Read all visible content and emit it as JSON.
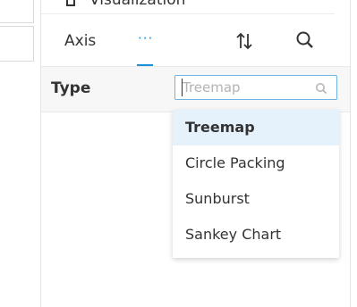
{
  "visualization": {
    "label": "Visualization",
    "more_glyph": "···"
  },
  "toolbar": {
    "axis_tab": "Axis",
    "more_glyph": "···"
  },
  "type_field": {
    "label": "Type",
    "placeholder": "Treemap",
    "value": ""
  },
  "dropdown": {
    "options": [
      "Treemap",
      "Circle Packing",
      "Sunburst",
      "Sankey Chart"
    ],
    "selected": "Treemap"
  },
  "colors": {
    "accent": "#1a8fd8",
    "selected_bg": "#e6f2fb",
    "row_bg": "#f7f7f7"
  }
}
